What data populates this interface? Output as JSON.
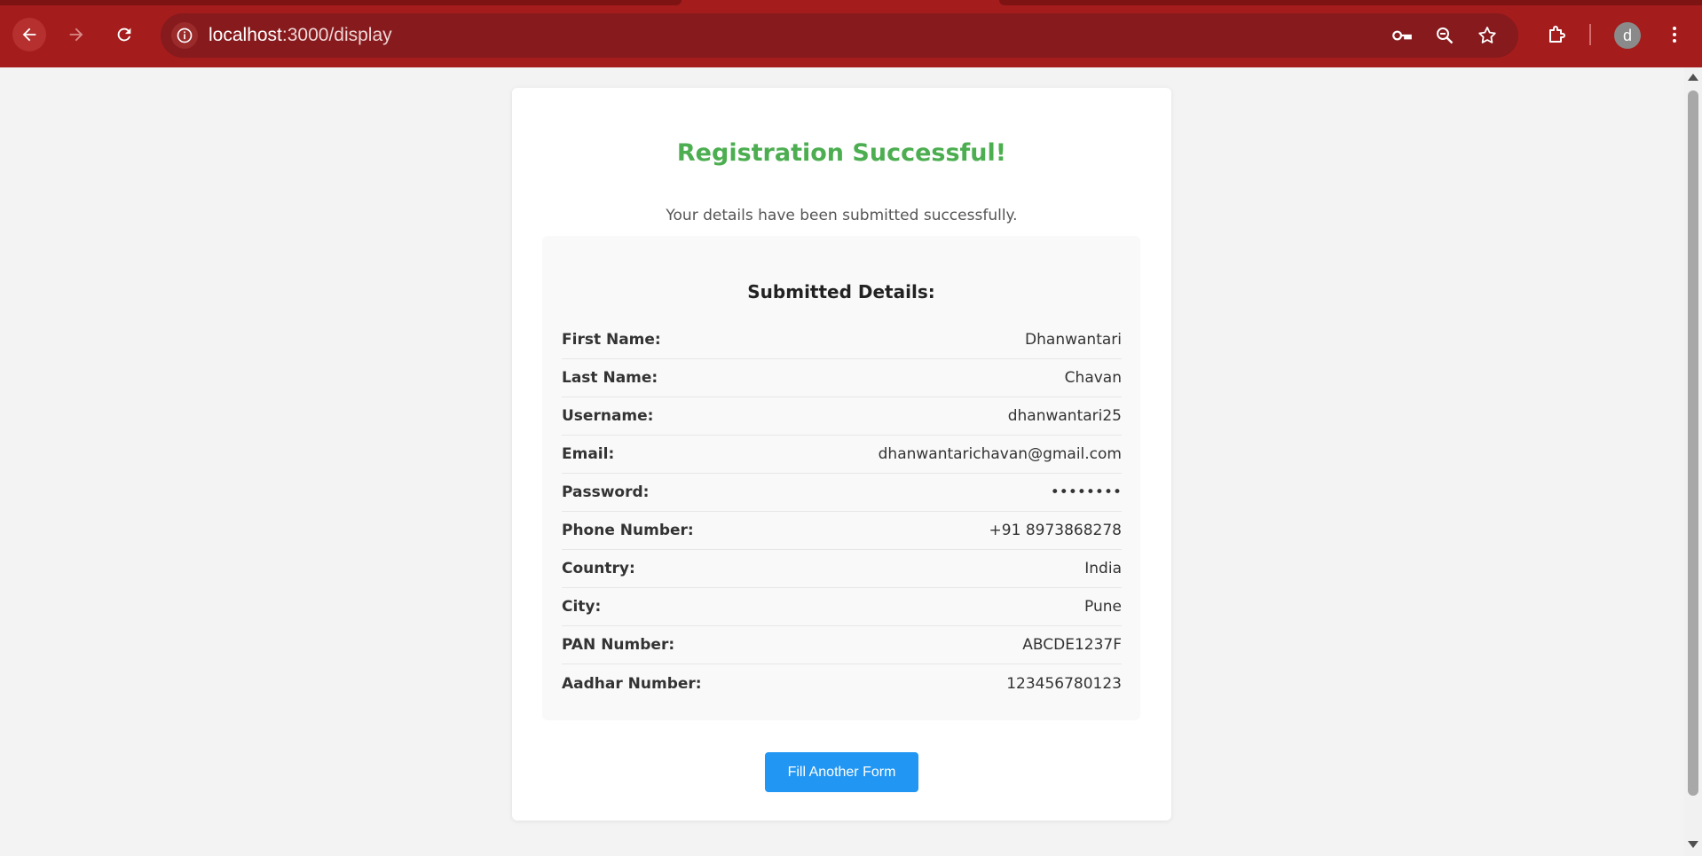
{
  "browser": {
    "url_host": "localhost",
    "url_path": ":3000/display",
    "profile_initial": "d",
    "colors": {
      "toolbar": "#a51c1c",
      "omnibox": "#861a1d"
    },
    "icons": [
      "back-arrow-icon",
      "forward-arrow-icon",
      "reload-icon",
      "site-info-icon",
      "password-key-icon",
      "zoom-icon",
      "bookmark-star-icon",
      "extensions-icon",
      "kebab-menu-icon"
    ]
  },
  "page": {
    "title": "Registration Successful!",
    "subtitle": "Your details have been submitted successfully.",
    "details_title": "Submitted Details:",
    "rows": [
      {
        "label": "First Name:",
        "value": "Dhanwantari"
      },
      {
        "label": "Last Name:",
        "value": "Chavan"
      },
      {
        "label": "Username:",
        "value": "dhanwantari25"
      },
      {
        "label": "Email:",
        "value": "dhanwantarichavan@gmail.com"
      },
      {
        "label": "Password:",
        "value": "••••••••"
      },
      {
        "label": "Phone Number:",
        "value": "+91 8973868278"
      },
      {
        "label": "Country:",
        "value": "India"
      },
      {
        "label": "City:",
        "value": "Pune"
      },
      {
        "label": "PAN Number:",
        "value": "ABCDE1237F"
      },
      {
        "label": "Aadhar Number:",
        "value": "123456780123"
      }
    ],
    "button_label": "Fill Another Form",
    "colors": {
      "title": "#4cae50",
      "button": "#2196f3"
    }
  }
}
